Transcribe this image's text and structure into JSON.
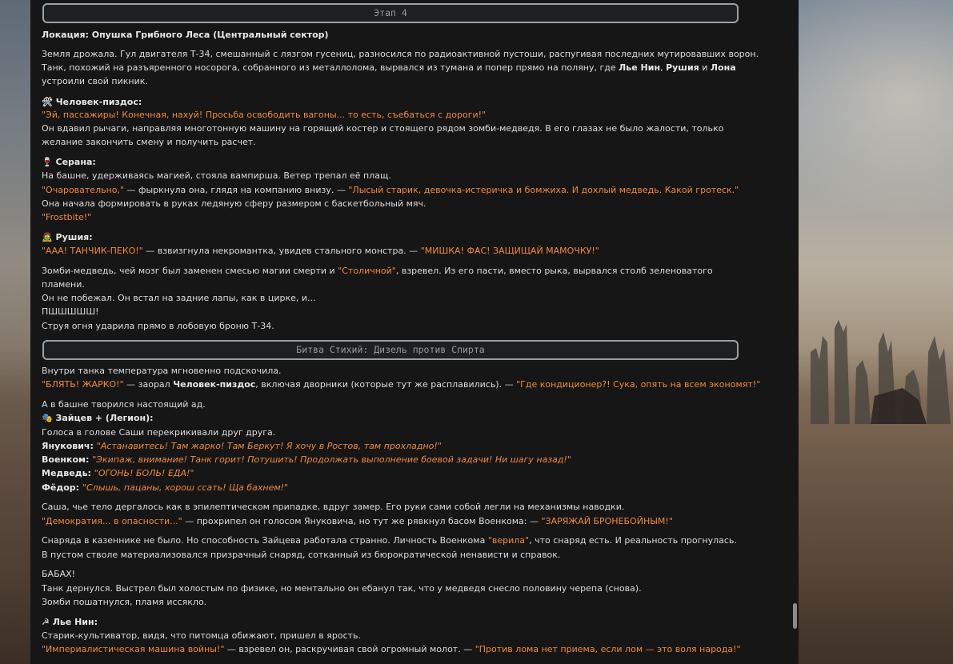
{
  "stage1": "Этап 4",
  "stage2": "Битва Стихий: Дизель против Спирта",
  "l1": {
    "a": "Локация: Опушка Грибного Леса (Центральный сектор)"
  },
  "l2": {
    "a": "Земля дрожала. Гул двигателя Т-34, смешанный с лязгом гусениц, разносился по радиоактивной пустоши, распугивая последних мутировавших ворон."
  },
  "l3": {
    "a": "Танк, похожий на разъяренного носорога, собранного из металлолома, вырвался из тумана и попер прямо на поляну, где ",
    "b": "Лье Нин",
    "c": ", ",
    "d": "Рушия",
    "e": " и ",
    "f": "Лона"
  },
  "l4": {
    "a": "устроили свой пикник."
  },
  "l5": {
    "a": "🛠 Человек-пиздос:"
  },
  "l6": {
    "a": "\"Эй, пассажиры! Конечная, нахуй! Просьба освободить вагоны... то есть, съебаться с дороги!\""
  },
  "l7": {
    "a": "Он вдавил рычаги, направляя многотонную машину на горящий костер и стоящего рядом зомби-медведя. В его глазах не было жалости, только"
  },
  "l8": {
    "a": "желание закончить смену и получить расчет."
  },
  "l9": {
    "a": "🍷 Серана:"
  },
  "l10": {
    "a": "На башне, удерживаясь магией, стояла вампирша. Ветер трепал её плащ."
  },
  "l11": {
    "a": "\"Очаровательно,\"",
    "b": " — фыркнула она, глядя на компанию внизу. — ",
    "c": "\"Лысый старик, девочка-истеричка и бомжиха. И дохлый медведь. Какой гротеск.\""
  },
  "l12": {
    "a": "Она начала формировать в руках ледяную сферу размером с баскетбольный мяч."
  },
  "l13": {
    "a": "\"Frostbite!\""
  },
  "l14": {
    "a": "🧟 Рушия:"
  },
  "l15": {
    "a": "\"ААА! ТАНЧИК-ПЕКО!\"",
    "b": " — взвизгнула некромантка, увидев стального монстра. — ",
    "c": "\"МИШКА! ФАС! ЗАЩИЩАЙ МАМОЧКУ!\""
  },
  "l16": {
    "a": "Зомби-медведь, чей мозг был заменен смесью магии смерти и ",
    "b": "\"Столичной\"",
    "c": ", взревел. Из его пасти, вместо рыка, вырвался столб зеленоватого"
  },
  "l17": {
    "a": "пламени."
  },
  "l18": {
    "a": "Он не побежал. Он встал на задние лапы, как в цирке, и..."
  },
  "l19": {
    "a": "ПШШШШШ!"
  },
  "l20": {
    "a": "Струя огня ударила прямо в лобовую броню Т-34."
  },
  "l21": {
    "a": "Внутри танка температура мгновенно подскочила."
  },
  "l22": {
    "a": "\"БЛЯТЬ! ЖАРКО!\"",
    "b": " — заорал ",
    "c": "Человек-пиздос",
    "d": ", включая дворники (которые тут же расплавились). — ",
    "e": "\"Где кондиционер?! Сука, опять на всем экономят!\""
  },
  "l23": {
    "a": "А в башне творился настоящий ад."
  },
  "l24": {
    "a": "🎭 Зайцев + (Легион):"
  },
  "l25": {
    "a": "Голоса в голове Саши перекрикивали друг друга."
  },
  "l26": {
    "a": "Янукович: ",
    "b": "\"Астанавитесь! Там жарко! Там Беркут! Я хочу в Ростов, там прохладно!\""
  },
  "l27": {
    "a": "Военком: ",
    "b": "\"Экипаж, внимание! Танк горит! Потушить! Продолжать выполнение боевой задачи! Ни шагу назад!\""
  },
  "l28": {
    "a": "Медведь: ",
    "b": "\"ОГОНЬ! БОЛЬ! ЕДА!\""
  },
  "l29": {
    "a": "Фёдор: ",
    "b": "\"Слышь, пацаны, хорош ссать! Ща бахнем!\""
  },
  "l30": {
    "a": "Саша, чье тело дергалось как в эпилептическом припадке, вдруг замер. Его руки сами собой легли на механизмы наводки."
  },
  "l31": {
    "a": "\"Демократия... в опасности...\"",
    "b": " — прохрипел он голосом Януковича, но тут же рявкнул басом Военкома: — ",
    "c": "\"ЗАРЯЖАЙ БРОНЕБОЙНЫМ!\""
  },
  "l32": {
    "a": "Снаряда в казеннике не было. Но способность Зайцева работала странно. Личность Военкома ",
    "b": "\"верила\"",
    "c": ", что снаряд есть. И реальность прогнулась."
  },
  "l33": {
    "a": "В пустом стволе материализовался призрачный снаряд, сотканный из бюрократической ненависти и справок."
  },
  "l34": {
    "a": "БАБАХ!"
  },
  "l35": {
    "a": "Танк дернулся. Выстрел был холостым по физике, но ментально он ебанул так, что у медведя снесло половину черепа (снова)."
  },
  "l36": {
    "a": "Зомби пошатнулся, пламя иссякло."
  },
  "l37": {
    "a": "☭ Лье Нин:"
  },
  "l38": {
    "a": "Старик-культиватор, видя, что питомца обижают, пришел в ярость."
  },
  "l39": {
    "a": "\"Империалистическая машина войны!\"",
    "b": " — взревел он, раскручивая свой огромный молот. — ",
    "c": "\"Против лома нет приема, если лом — это воля народа!\""
  }
}
